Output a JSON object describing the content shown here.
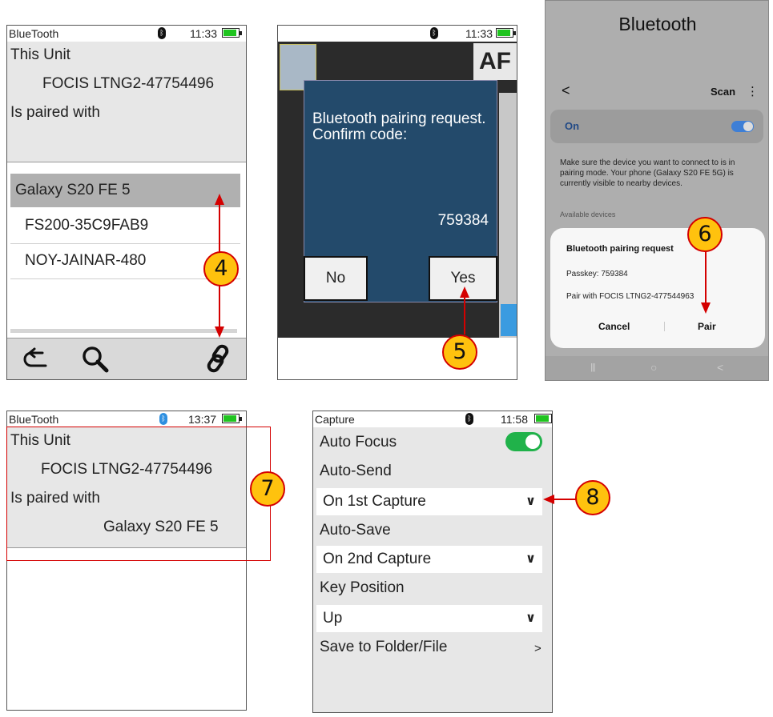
{
  "screen1": {
    "status": {
      "title": "BlueTooth",
      "time": "11:33"
    },
    "this_unit_label": "This Unit",
    "unit_name": "FOCIS LTNG2-47754496",
    "paired_label": "Is paired with",
    "devices": [
      "Galaxy S20 FE 5",
      "FS200-35C9FAB9",
      "NOY-JAINAR-480"
    ],
    "icons": [
      "back-arrow-icon",
      "search-icon",
      "link-icon"
    ]
  },
  "screen2": {
    "status": {
      "time": "11:33"
    },
    "af_label": "AF",
    "dialog": {
      "message": "Bluetooth pairing request.\nConfirm code:",
      "code": "759384",
      "no_label": "No",
      "yes_label": "Yes"
    }
  },
  "screen3": {
    "title": "Bluetooth",
    "back_glyph": "<",
    "scan_label": "Scan",
    "more_glyph": "⋮",
    "on_label": "On",
    "info_text": "Make sure the device you want to connect to is in pairing mode. Your phone (Galaxy S20 FE 5G) is currently visible to nearby devices.",
    "available_label": "Available devices",
    "dialog": {
      "title": "Bluetooth pairing request",
      "passkey": "Passkey: 759384",
      "pair_with": "Pair with FOCIS LTNG2-477544963",
      "cancel_label": "Cancel",
      "pair_label": "Pair"
    },
    "nav": {
      "recent": "|||",
      "home": "○",
      "back": "<"
    }
  },
  "screen4": {
    "status": {
      "title": "BlueTooth",
      "time": "13:37"
    },
    "this_unit_label": "This Unit",
    "unit_name": "FOCIS LTNG2-47754496",
    "paired_label": "Is paired with",
    "paired_device": "Galaxy S20 FE 5"
  },
  "screen5": {
    "status": {
      "title": "Capture",
      "time": "11:58"
    },
    "auto_focus_label": "Auto Focus",
    "auto_focus_on": true,
    "auto_send_label": "Auto-Send",
    "auto_send_value": "On 1st Capture",
    "auto_save_label": "Auto-Save",
    "auto_save_value": "On 2nd Capture",
    "key_position_label": "Key Position",
    "key_position_value": "Up",
    "save_folder_label": "Save to Folder/File",
    "save_folder_glyph": ">"
  },
  "annotations": [
    "4",
    "5",
    "6",
    "7",
    "8"
  ],
  "colors": {
    "accent_red": "#d40000",
    "badge_yellow": "#ffc20e",
    "dialog_blue": "#234a6b",
    "toggle_green": "#20b24a",
    "android_blue": "#3e7fd6"
  }
}
